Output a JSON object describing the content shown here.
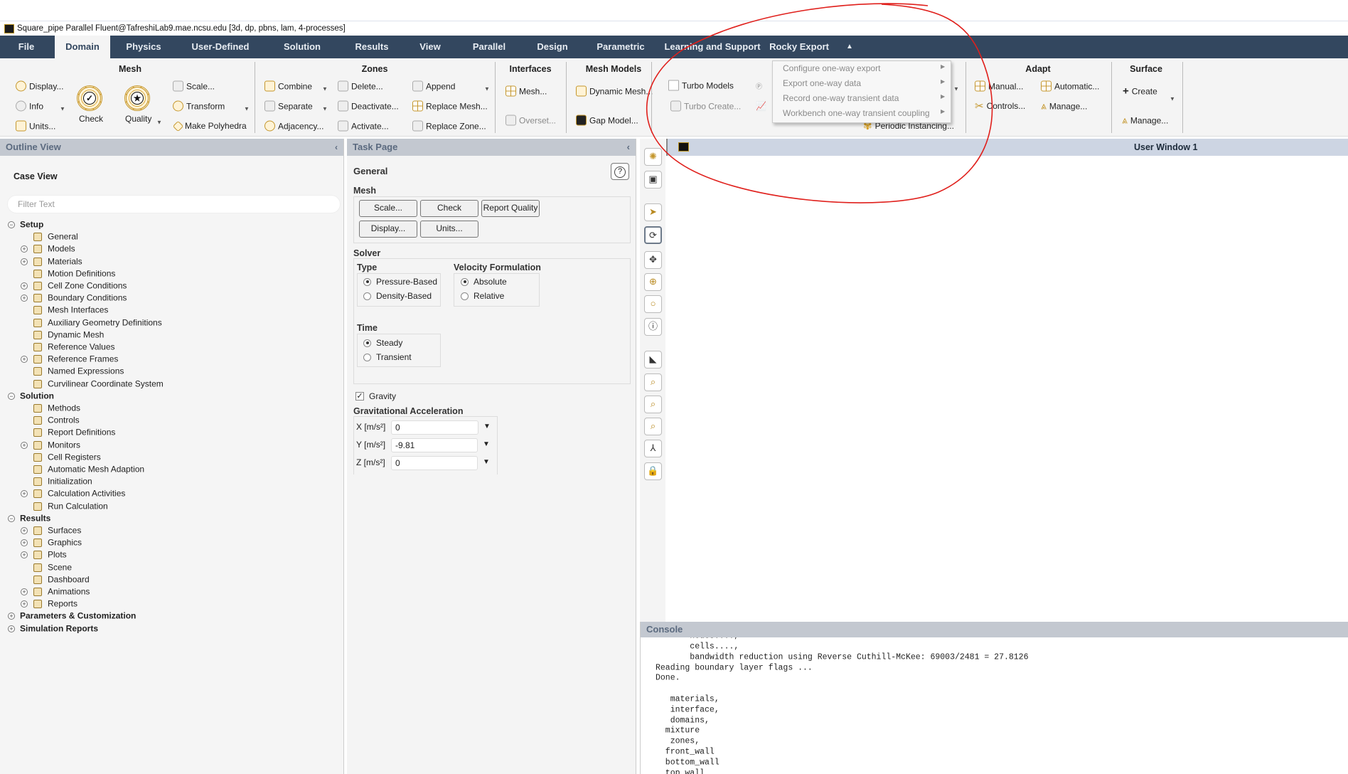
{
  "window": {
    "title": "Square_pipe Parallel Fluent@TafreshiLab9.mae.ncsu.edu  [3d, dp, pbns, lam, 4-processes]"
  },
  "tabs": [
    "File",
    "Domain",
    "Physics",
    "User-Defined",
    "Solution",
    "Results",
    "View",
    "Parallel",
    "Design",
    "Parametric",
    "Learning and Support",
    "Rocky Export"
  ],
  "active_tab": "Domain",
  "ribbon": {
    "mesh": {
      "title": "Mesh",
      "display": "Display...",
      "info": "Info",
      "units": "Units...",
      "check": "Check",
      "quality": "Quality",
      "scale": "Scale...",
      "transform": "Transform",
      "make_polyhedra": "Make Polyhedra"
    },
    "zones": {
      "title": "Zones",
      "combine": "Combine",
      "separate": "Separate",
      "adjacency": "Adjacency...",
      "delete": "Delete...",
      "deactivate": "Deactivate...",
      "activate": "Activate...",
      "append": "Append",
      "replace_mesh": "Replace Mesh...",
      "replace_zone": "Replace Zone..."
    },
    "interfaces": {
      "title": "Interfaces",
      "mesh": "Mesh...",
      "overset": "Overset..."
    },
    "mesh_models": {
      "title": "Mesh Models",
      "dynamic_mesh": "Dynamic Mesh...",
      "gap_model": "Gap Model..."
    },
    "turbo": {
      "turbo_models": "Turbo Models",
      "turbo_create": "Turbo Create...",
      "periodic": "Periodic Instancing..."
    },
    "adapt": {
      "title": "Adapt",
      "manual": "Manual...",
      "automatic": "Automatic...",
      "controls": "Controls...",
      "manage": "Manage..."
    },
    "surface": {
      "title": "Surface",
      "create": "Create",
      "manage": "Manage..."
    }
  },
  "rocky_menu": [
    "Configure one-way export",
    "Export one-way data",
    "Record one-way transient data",
    "Workbench one-way transient coupling"
  ],
  "outline": {
    "header": "Outline View",
    "case_view": "Case View",
    "filter_placeholder": "Filter Text",
    "tree": [
      {
        "t": "Setup",
        "sec": true,
        "exp": "−"
      },
      {
        "t": "General"
      },
      {
        "t": "Models",
        "exp": "+"
      },
      {
        "t": "Materials",
        "exp": "+"
      },
      {
        "t": "Motion Definitions"
      },
      {
        "t": "Cell Zone Conditions",
        "exp": "+"
      },
      {
        "t": "Boundary Conditions",
        "exp": "+"
      },
      {
        "t": "Mesh Interfaces"
      },
      {
        "t": "Auxiliary Geometry Definitions"
      },
      {
        "t": "Dynamic Mesh"
      },
      {
        "t": "Reference Values"
      },
      {
        "t": "Reference Frames",
        "exp": "+"
      },
      {
        "t": "Named Expressions"
      },
      {
        "t": "Curvilinear Coordinate System"
      },
      {
        "t": "Solution",
        "sec": true,
        "exp": "−"
      },
      {
        "t": "Methods"
      },
      {
        "t": "Controls"
      },
      {
        "t": "Report Definitions"
      },
      {
        "t": "Monitors",
        "exp": "+"
      },
      {
        "t": "Cell Registers"
      },
      {
        "t": "Automatic Mesh Adaption"
      },
      {
        "t": "Initialization"
      },
      {
        "t": "Calculation Activities",
        "exp": "+"
      },
      {
        "t": "Run Calculation"
      },
      {
        "t": "Results",
        "sec": true,
        "exp": "−"
      },
      {
        "t": "Surfaces",
        "exp": "+"
      },
      {
        "t": "Graphics",
        "exp": "+"
      },
      {
        "t": "Plots",
        "exp": "+"
      },
      {
        "t": "Scene"
      },
      {
        "t": "Dashboard"
      },
      {
        "t": "Animations",
        "exp": "+"
      },
      {
        "t": "Reports",
        "exp": "+"
      },
      {
        "t": "Parameters & Customization",
        "sec": true,
        "exp": "+"
      },
      {
        "t": "Simulation Reports",
        "sec": true,
        "exp": "+"
      }
    ]
  },
  "task": {
    "header": "Task Page",
    "title": "General",
    "mesh_label": "Mesh",
    "buttons": {
      "scale": "Scale...",
      "check": "Check",
      "report_quality": "Report Quality",
      "display": "Display...",
      "units": "Units..."
    },
    "solver_label": "Solver",
    "type_label": "Type",
    "pressure_based": "Pressure-Based",
    "density_based": "Density-Based",
    "velocity_label": "Velocity Formulation",
    "absolute": "Absolute",
    "relative": "Relative",
    "time_label": "Time",
    "steady": "Steady",
    "transient": "Transient",
    "gravity": "Gravity",
    "gravity_checked": true,
    "grav_accel_label": "Gravitational Acceleration",
    "x_label": "X [m/s²]",
    "x": "0",
    "y_label": "Y [m/s²]",
    "y": "-9.81",
    "z_label": "Z [m/s²]",
    "z": "0"
  },
  "graphics": {
    "window_title": "User Window 1"
  },
  "console": {
    "header": "Console",
    "lines": [
      "       nodes....,",
      "       cells....,",
      "       bandwidth reduction using Reverse Cuthill-McKee: 69003/2481 = 27.8126",
      "Reading boundary layer flags ...",
      "Done.",
      "",
      "   materials,",
      "   interface,",
      "   domains,",
      "  mixture",
      "   zones,",
      "  front_wall",
      "  bottom_wall",
      "  top_wall"
    ]
  },
  "colors": {
    "tabbar": "#33475f",
    "accent": "#c4962c",
    "annotation": "#e0201c"
  }
}
